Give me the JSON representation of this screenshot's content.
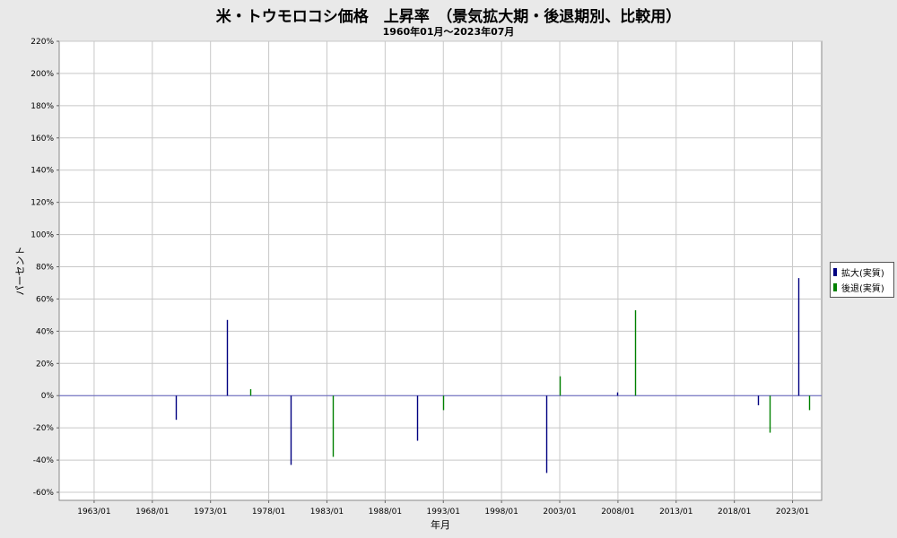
{
  "chart_data": {
    "type": "bar",
    "title": "米・トウモロコシ価格　上昇率　（景気拡大期・後退期別、比較用）",
    "subtitle": "1960年01月～2023年07月",
    "xlabel": "年月",
    "ylabel": "パーセント",
    "x_range": [
      "1960/01",
      "2025/07"
    ],
    "ylim": [
      -65,
      220
    ],
    "y_ticks": [
      "220%",
      "200%",
      "180%",
      "160%",
      "140%",
      "120%",
      "100%",
      "80%",
      "60%",
      "40%",
      "20%",
      "0%",
      "-20%",
      "-40%",
      "-60%"
    ],
    "x_ticks": [
      "1963/01",
      "1968/01",
      "1973/01",
      "1978/01",
      "1983/01",
      "1988/01",
      "1993/01",
      "1998/01",
      "2003/01",
      "2008/01",
      "2013/01",
      "2018/01",
      "2023/01"
    ],
    "grid": true,
    "legend_position": "right",
    "series": [
      {
        "name": "拡大(実質)",
        "color": "#000080",
        "points": [
          {
            "x": "1970/01",
            "y": -15
          },
          {
            "x": "1974/06",
            "y": 47
          },
          {
            "x": "1979/12",
            "y": -43
          },
          {
            "x": "1990/10",
            "y": -28
          },
          {
            "x": "2001/11",
            "y": -48
          },
          {
            "x": "2007/12",
            "y": 2
          },
          {
            "x": "2020/01",
            "y": -6
          },
          {
            "x": "2023/07",
            "y": 73
          }
        ]
      },
      {
        "name": "後退(実質)",
        "color": "#008000",
        "points": [
          {
            "x": "1976/06",
            "y": 4
          },
          {
            "x": "1983/07",
            "y": -38
          },
          {
            "x": "1993/01",
            "y": -9
          },
          {
            "x": "2003/01",
            "y": 12
          },
          {
            "x": "2009/07",
            "y": 53
          },
          {
            "x": "2021/01",
            "y": -23
          },
          {
            "x": "2024/06",
            "y": -9
          }
        ]
      }
    ]
  }
}
